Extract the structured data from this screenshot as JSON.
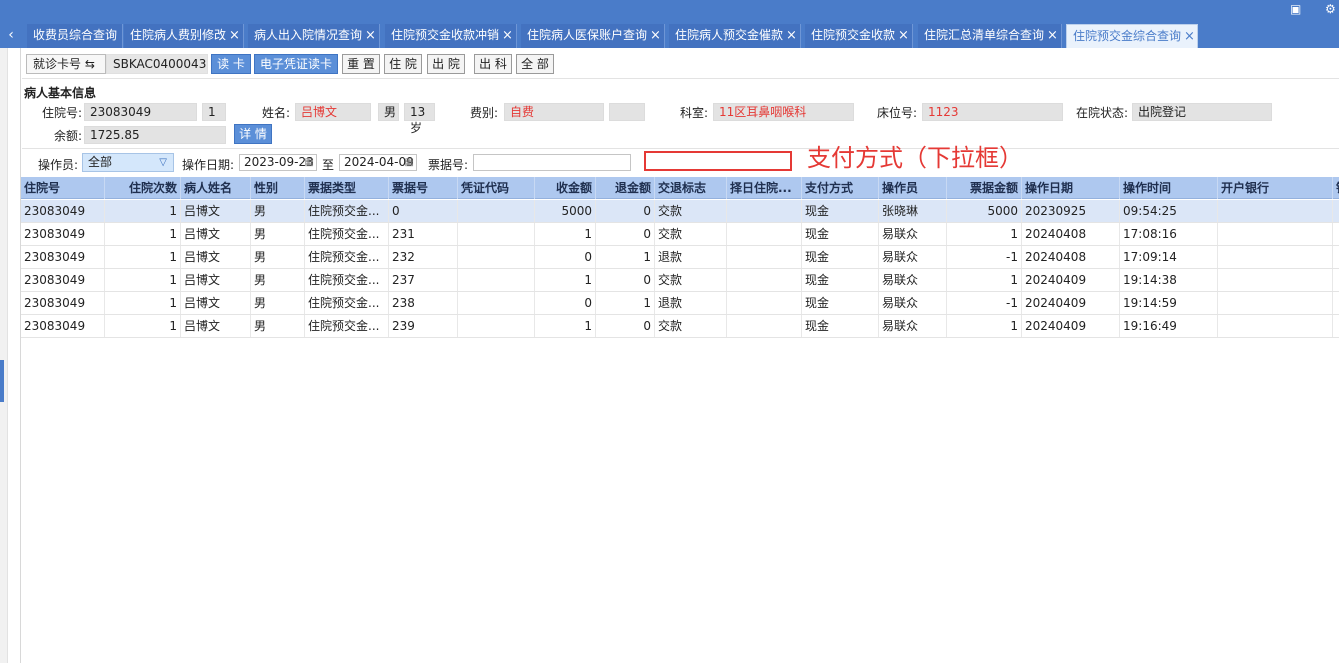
{
  "tabs": [
    {
      "label": "收费员综合查询",
      "closable": false
    },
    {
      "label": "住院病人费别修改",
      "closable": true
    },
    {
      "label": "病人出入院情况查询",
      "closable": true
    },
    {
      "label": "住院预交金收款冲销",
      "closable": true
    },
    {
      "label": "住院病人医保账户查询",
      "closable": true
    },
    {
      "label": "住院病人预交金催款",
      "closable": true
    },
    {
      "label": "住院预交金收款",
      "closable": true
    },
    {
      "label": "住院汇总清单综合查询",
      "closable": true
    },
    {
      "label": "住院预交金综合查询",
      "closable": true,
      "active": true
    }
  ],
  "toolbar": {
    "card_label": "就诊卡号 ⇆",
    "card_value": "SBKAC0400043",
    "read_card": "读 卡",
    "e_voucher": "电子凭证读卡",
    "reset": "重 置",
    "in_hospital": "住 院",
    "discharged": "出 院",
    "out_dept": "出 科",
    "all": "全 部"
  },
  "patient": {
    "section_title": "病人基本信息",
    "admission_no_label": "住院号:",
    "admission_no": "23083049",
    "admission_count": "1",
    "name_label": "姓名:",
    "name": "吕博文",
    "gender": "男",
    "age": "13岁",
    "fee_type_label": "费别:",
    "fee_type": "自费",
    "fee_extra": "",
    "dept_label": "科室:",
    "dept": "11区耳鼻咽喉科",
    "bed_label": "床位号:",
    "bed": "1123",
    "status_label": "在院状态:",
    "status": "出院登记",
    "balance_label": "余额:",
    "balance": "1725.85",
    "detail_button": "详 情"
  },
  "filter": {
    "operator_label": "操作员:",
    "operator_value": "全部",
    "date_label": "操作日期:",
    "date_from": "2023-09-23",
    "to_label": "至",
    "date_to": "2024-04-09",
    "invoice_label": "票据号:",
    "invoice_value": ""
  },
  "annotation": {
    "text": "支付方式（下拉框）",
    "color": "#e53935"
  },
  "table": {
    "columns": [
      "住院号",
      "住院次数",
      "病人姓名",
      "性别",
      "票据类型",
      "票据号",
      "凭证代码",
      "收金额",
      "退金额",
      "交退标志",
      "择日住院...",
      "支付方式",
      "操作员",
      "票据金额",
      "操作日期",
      "操作时间",
      "开户银行",
      "银"
    ],
    "rows": [
      [
        "23083049",
        "1",
        "吕博文",
        "男",
        "住院预交金...",
        "0",
        "",
        "5000",
        "0",
        "交款",
        "",
        "现金",
        "张晓琳",
        "5000",
        "20230925",
        "09:54:25",
        "",
        ""
      ],
      [
        "23083049",
        "1",
        "吕博文",
        "男",
        "住院预交金...",
        "231",
        "",
        "1",
        "0",
        "交款",
        "",
        "现金",
        "易联众",
        "1",
        "20240408",
        "17:08:16",
        "",
        ""
      ],
      [
        "23083049",
        "1",
        "吕博文",
        "男",
        "住院预交金...",
        "232",
        "",
        "0",
        "1",
        "退款",
        "",
        "现金",
        "易联众",
        "-1",
        "20240408",
        "17:09:14",
        "",
        ""
      ],
      [
        "23083049",
        "1",
        "吕博文",
        "男",
        "住院预交金...",
        "237",
        "",
        "1",
        "0",
        "交款",
        "",
        "现金",
        "易联众",
        "1",
        "20240409",
        "19:14:38",
        "",
        ""
      ],
      [
        "23083049",
        "1",
        "吕博文",
        "男",
        "住院预交金...",
        "238",
        "",
        "0",
        "1",
        "退款",
        "",
        "现金",
        "易联众",
        "-1",
        "20240409",
        "19:14:59",
        "",
        ""
      ],
      [
        "23083049",
        "1",
        "吕博文",
        "男",
        "住院预交金...",
        "239",
        "",
        "1",
        "0",
        "交款",
        "",
        "现金",
        "易联众",
        "1",
        "20240409",
        "19:16:49",
        "",
        ""
      ]
    ]
  },
  "colors": {
    "topbar": "#4a7cc9",
    "header": "#aec8ef",
    "button_blue": "#5b8fd8",
    "selected_row": "#dbe6f7",
    "red_text": "#e53935"
  },
  "icons": [
    "tab-scroll-left-icon",
    "close-icon",
    "calendar-icon",
    "chevron-down-icon",
    "window-icon",
    "settings-icon"
  ]
}
